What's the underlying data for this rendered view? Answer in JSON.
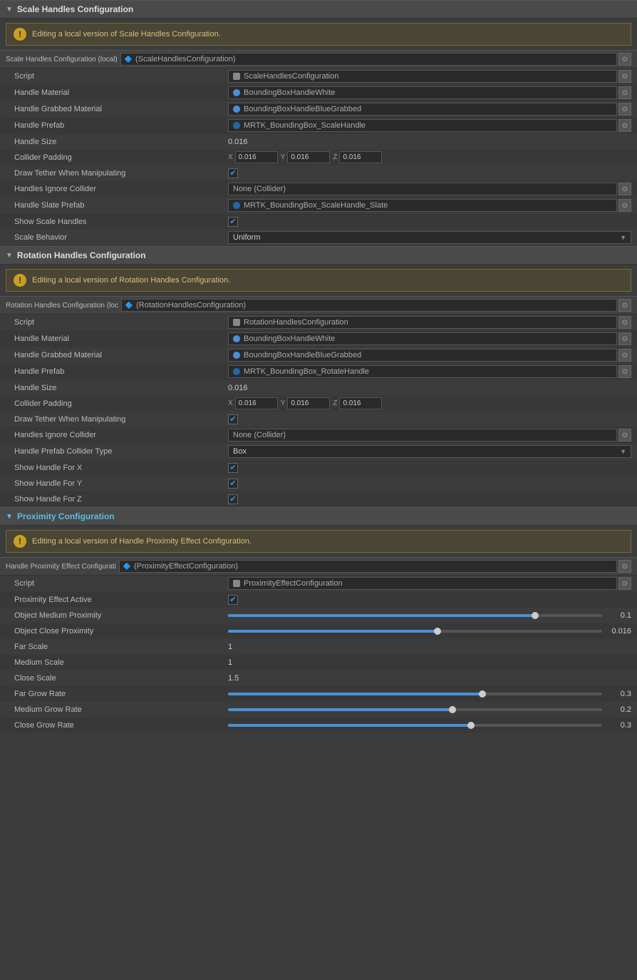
{
  "scale_section": {
    "title": "Scale Handles Configuration",
    "warning": "Editing a local version of Scale Handles Configuration.",
    "config_ref_label": "Scale Handles Configuration (local)",
    "config_ref_icon": "🔷",
    "config_ref_value": "(ScaleHandlesConfiguration)",
    "fields": [
      {
        "label": "Script",
        "type": "object",
        "dot": "script",
        "value": "ScaleHandlesConfiguration"
      },
      {
        "label": "Handle Material",
        "type": "object",
        "dot": "blue",
        "value": "BoundingBoxHandleWhite"
      },
      {
        "label": "Handle Grabbed Material",
        "type": "object",
        "dot": "blue",
        "value": "BoundingBoxHandleBlueGrabbed"
      },
      {
        "label": "Handle Prefab",
        "type": "object",
        "dot": "darkblue",
        "value": "MRTK_BoundingBox_ScaleHandle"
      },
      {
        "label": "Handle Size",
        "type": "text",
        "value": "0.016"
      },
      {
        "label": "Collider Padding",
        "type": "xyz",
        "x": "0.016",
        "y": "0.016",
        "z": "0.016"
      },
      {
        "label": "Draw Tether When Manipulating",
        "type": "checkbox",
        "checked": true
      },
      {
        "label": "Handles Ignore Collider",
        "type": "object",
        "dot": "none",
        "value": "None (Collider)"
      },
      {
        "label": "Handle Slate Prefab",
        "type": "object",
        "dot": "darkblue",
        "value": "MRTK_BoundingBox_ScaleHandle_Slate"
      },
      {
        "label": "Show Scale Handles",
        "type": "checkbox",
        "checked": true
      },
      {
        "label": "Scale Behavior",
        "type": "dropdown",
        "value": "Uniform"
      }
    ]
  },
  "rotation_section": {
    "title": "Rotation Handles Configuration",
    "warning": "Editing a local version of Rotation Handles Configuration.",
    "config_ref_label": "Rotation Handles Configuration (loc",
    "config_ref_icon": "🔷",
    "config_ref_value": "(RotationHandlesConfiguration)",
    "fields": [
      {
        "label": "Script",
        "type": "object",
        "dot": "script",
        "value": "RotationHandlesConfiguration"
      },
      {
        "label": "Handle Material",
        "type": "object",
        "dot": "blue",
        "value": "BoundingBoxHandleWhite"
      },
      {
        "label": "Handle Grabbed Material",
        "type": "object",
        "dot": "blue",
        "value": "BoundingBoxHandleBlueGrabbed"
      },
      {
        "label": "Handle Prefab",
        "type": "object",
        "dot": "darkblue",
        "value": "MRTK_BoundingBox_RotateHandle"
      },
      {
        "label": "Handle Size",
        "type": "text",
        "value": "0.016"
      },
      {
        "label": "Collider Padding",
        "type": "xyz",
        "x": "0.016",
        "y": "0.016",
        "z": "0.016"
      },
      {
        "label": "Draw Tether When Manipulating",
        "type": "checkbox",
        "checked": true
      },
      {
        "label": "Handles Ignore Collider",
        "type": "object",
        "dot": "none",
        "value": "None (Collider)"
      },
      {
        "label": "Handle Prefab Collider Type",
        "type": "dropdown",
        "value": "Box"
      },
      {
        "label": "Show Handle For X",
        "type": "checkbox",
        "checked": true
      },
      {
        "label": "Show Handle For Y",
        "type": "checkbox",
        "checked": true
      },
      {
        "label": "Show Handle For Z",
        "type": "checkbox",
        "checked": true
      }
    ]
  },
  "proximity_section": {
    "title": "Proximity Configuration",
    "title_color": "#5ad",
    "warning": "Editing a local version of Handle Proximity Effect Configuration.",
    "config_ref_label": "Handle Proximity Effect Configurati",
    "config_ref_icon": "🔷",
    "config_ref_value": "(ProximityEffectConfiguration)",
    "fields": [
      {
        "label": "Script",
        "type": "object",
        "dot": "script",
        "value": "ProximityEffectConfiguration"
      },
      {
        "label": "Proximity Effect Active",
        "type": "checkbox",
        "checked": true
      },
      {
        "label": "Object Medium Proximity",
        "type": "slider",
        "fill_pct": 82,
        "thumb_pct": 82,
        "value": "0.1"
      },
      {
        "label": "Object Close Proximity",
        "type": "slider",
        "fill_pct": 56,
        "thumb_pct": 56,
        "value": "0.016"
      },
      {
        "label": "Far Scale",
        "type": "text",
        "value": "1"
      },
      {
        "label": "Medium Scale",
        "type": "text",
        "value": "1"
      },
      {
        "label": "Close Scale",
        "type": "text",
        "value": "1.5"
      },
      {
        "label": "Far Grow Rate",
        "type": "slider",
        "fill_pct": 68,
        "thumb_pct": 68,
        "value": "0.3"
      },
      {
        "label": "Medium Grow Rate",
        "type": "slider",
        "fill_pct": 60,
        "thumb_pct": 60,
        "value": "0.2"
      },
      {
        "label": "Close Grow Rate",
        "type": "slider",
        "fill_pct": 65,
        "thumb_pct": 65,
        "value": "0.3"
      }
    ]
  },
  "labels": {
    "gear": "⚙",
    "check": "✔",
    "arrow_down": "▼",
    "arrow_right": "▶"
  }
}
